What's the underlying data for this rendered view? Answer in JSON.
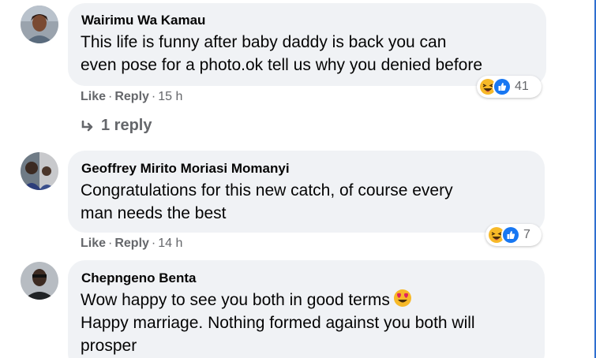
{
  "comments": [
    {
      "author": "Wairimu Wa Kamau",
      "lines": [
        "This life is funny after baby daddy is back you can",
        "even pose for a photo.ok tell us why you denied before"
      ],
      "reactions": {
        "icons": [
          "haha-icon",
          "like-icon"
        ],
        "count": "41"
      },
      "actions": {
        "like": "Like",
        "reply": "Reply",
        "time": "15 h"
      },
      "replies_label": "1 reply"
    },
    {
      "author": "Geoffrey Mirito Moriasi Momanyi",
      "lines": [
        "Congratulations for this new catch, of course every",
        "man needs the best"
      ],
      "reactions": {
        "icons": [
          "haha-icon",
          "like-icon"
        ],
        "count": "7"
      },
      "actions": {
        "like": "Like",
        "reply": "Reply",
        "time": "14 h"
      }
    },
    {
      "author": "Chepngeno Benta",
      "lines": [
        "Wow happy to see you both in good terms",
        "Happy marriage. Nothing formed against you both will",
        "prosper"
      ],
      "inline_emoji": "heart-eyes-emoji"
    }
  ],
  "colors": {
    "bubble": "#f0f2f5",
    "meta_text": "#65676b",
    "body_text": "#050505",
    "like_blue": "#1877f2",
    "haha_yellow": "#f7b928"
  }
}
